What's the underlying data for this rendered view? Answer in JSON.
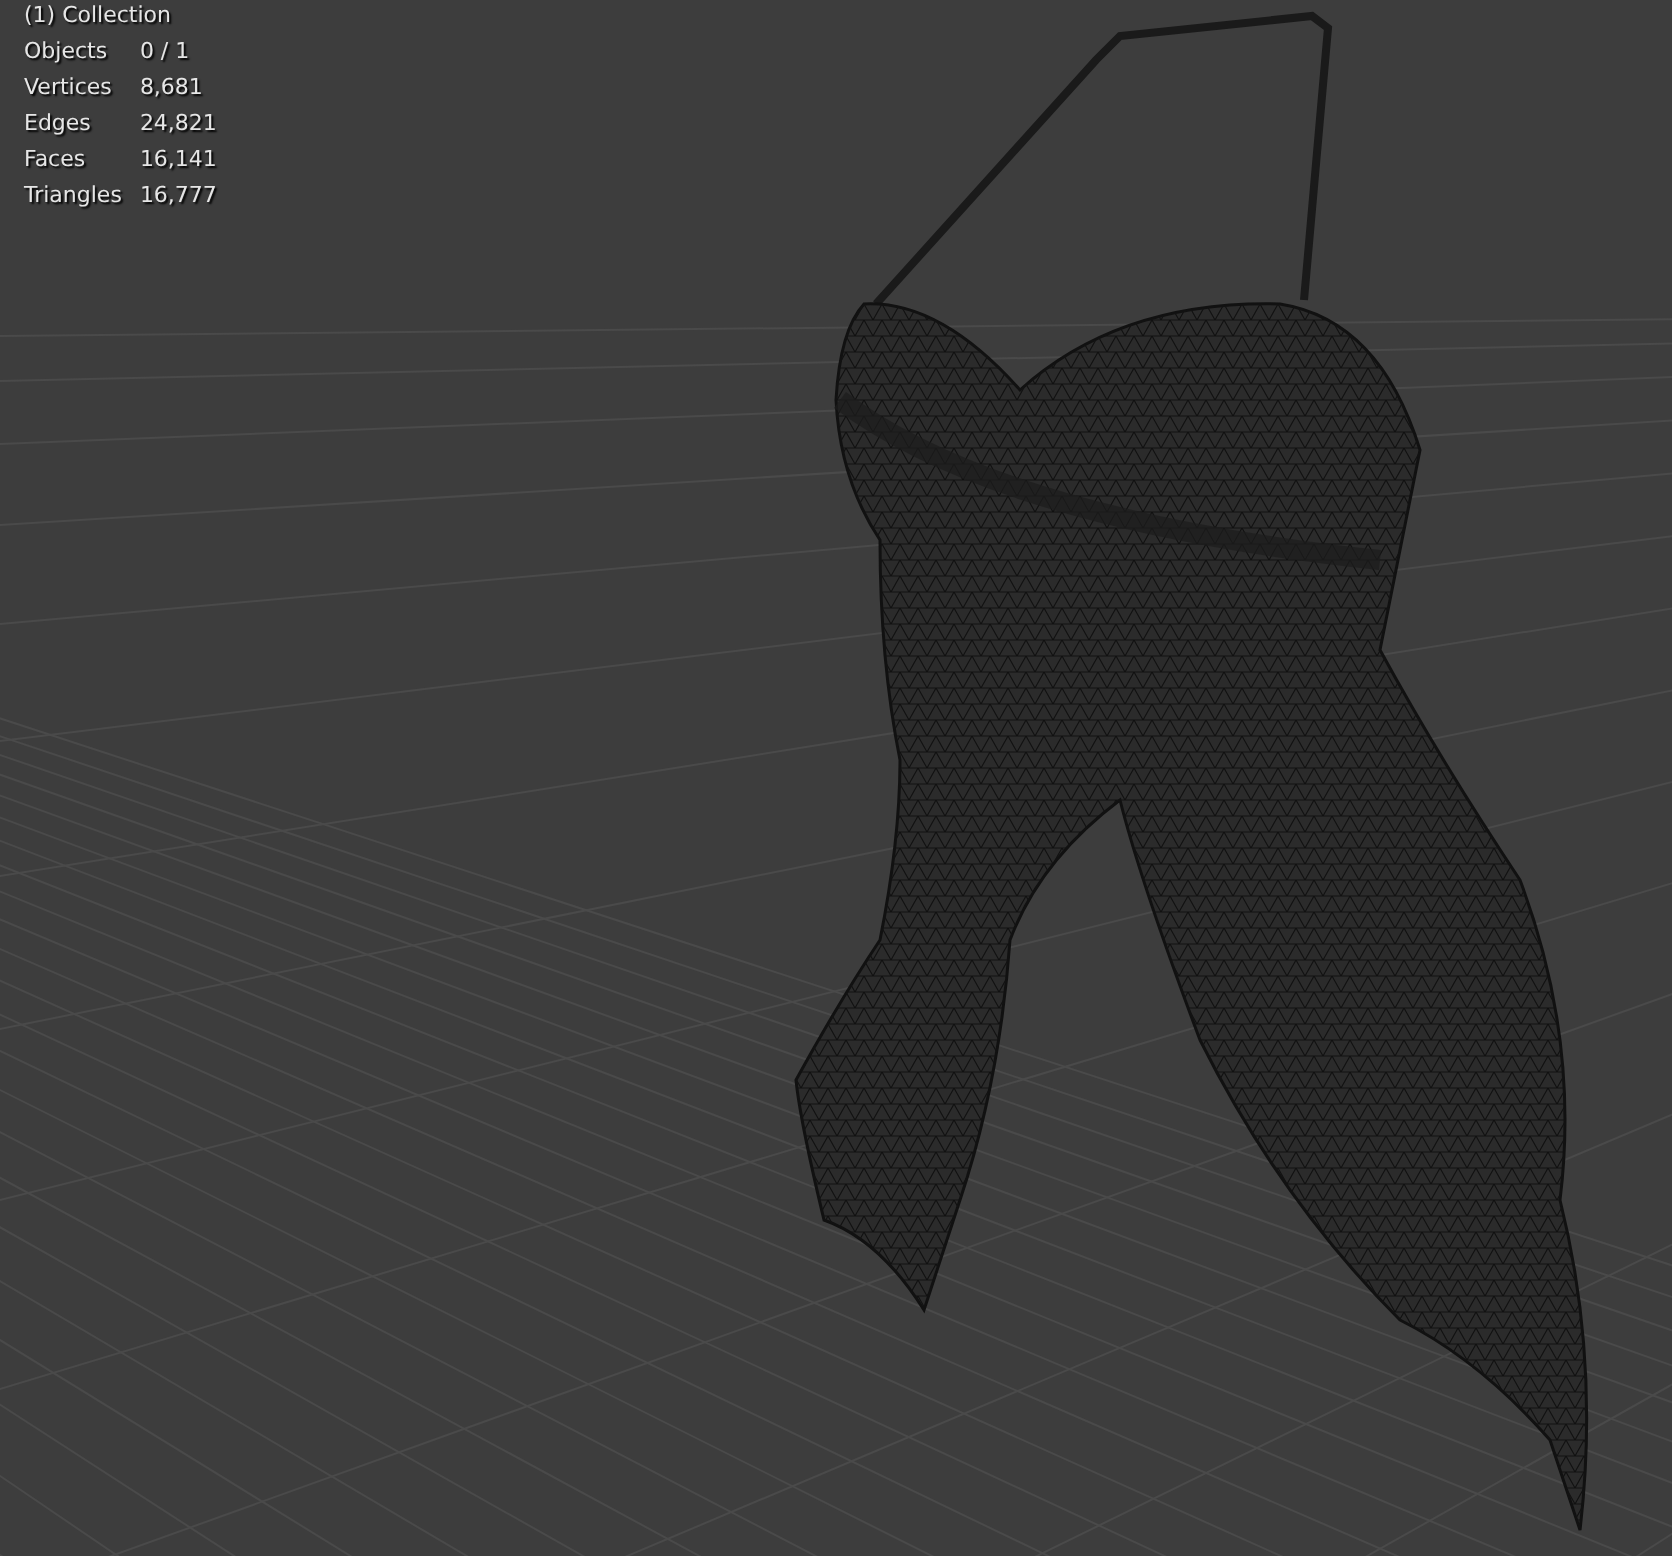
{
  "viewport": {
    "collection": "(1) Collection",
    "stats": [
      {
        "label": "Objects",
        "value": "0 / 1"
      },
      {
        "label": "Vertices",
        "value": "8,681"
      },
      {
        "label": "Edges",
        "value": "24,821"
      },
      {
        "label": "Faces",
        "value": "16,141"
      },
      {
        "label": "Triangles",
        "value": "16,777"
      }
    ]
  }
}
